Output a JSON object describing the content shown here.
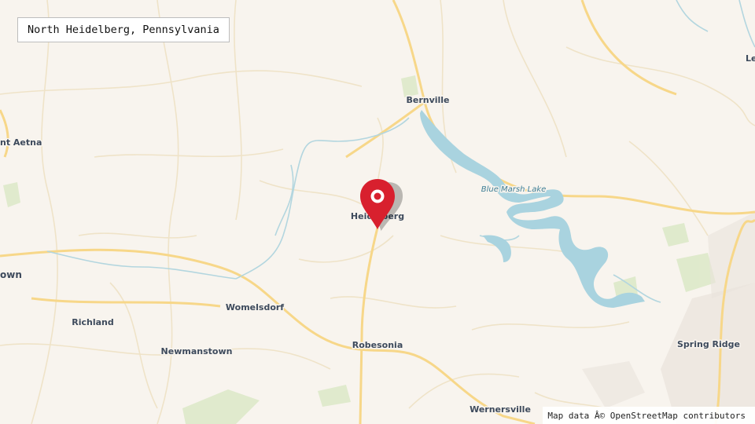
{
  "map": {
    "title": "North Heidelberg, Pennsylvania",
    "attribution": "Map data Â© OpenStreetMap contributors",
    "marker_icon": "map-pin-icon",
    "colors": {
      "land": "#f8f4ee",
      "road_major": "#f6d78a",
      "road_minor": "#f3e7cc",
      "water": "#a9d3df",
      "park": "#d9e8c4",
      "marker": "#d8202e"
    },
    "places": {
      "bernville": "Bernville",
      "mount_aetna": "nt Aetna",
      "heidelberg": "Heidelberg",
      "blue_marsh_lake": "Blue Marsh Lake",
      "town_left": "own",
      "womelsdorf": "Womelsdorf",
      "richland": "Richland",
      "robesonia": "Robesonia",
      "newmanstown": "Newmanstown",
      "spring_ridge": "Spring Ridge",
      "wernersville": "Wernersville",
      "lee_edge": "Le"
    }
  }
}
